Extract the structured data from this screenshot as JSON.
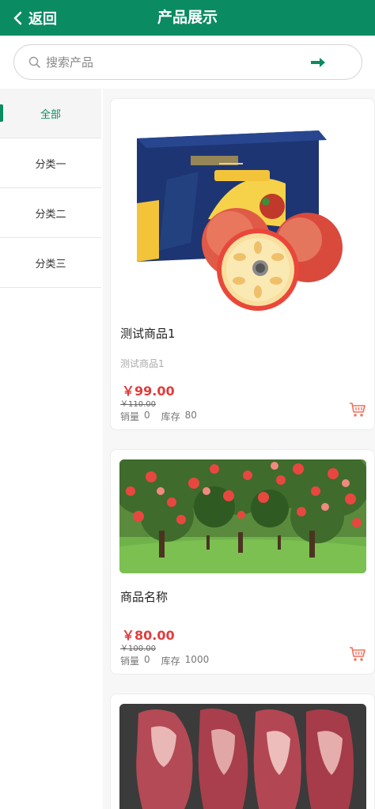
{
  "header": {
    "back_label": "返回",
    "title": "产品展示"
  },
  "search": {
    "placeholder": "搜索产品",
    "value": ""
  },
  "sidebar": {
    "items": [
      {
        "label": "全部",
        "active": true
      },
      {
        "label": "分类一",
        "active": false
      },
      {
        "label": "分类二",
        "active": false
      },
      {
        "label": "分类三",
        "active": false
      }
    ]
  },
  "products": [
    {
      "name": "测试商品1",
      "desc": "测试商品1",
      "price": "￥99.00",
      "orig_price": "￥110.00",
      "sales_label": "销量",
      "sales": "0",
      "stock_label": "库存",
      "stock": "80",
      "image": "apple-gift-box"
    },
    {
      "name": "商品名称",
      "desc": "",
      "price": "￥80.00",
      "orig_price": "￥100.00",
      "sales_label": "销量",
      "sales": "0",
      "stock_label": "库存",
      "stock": "1000",
      "image": "apple-orchard"
    },
    {
      "name": "",
      "image": "raw-meat-slices"
    }
  ],
  "colors": {
    "brand": "#0b8b61",
    "price": "#e23b3b"
  }
}
